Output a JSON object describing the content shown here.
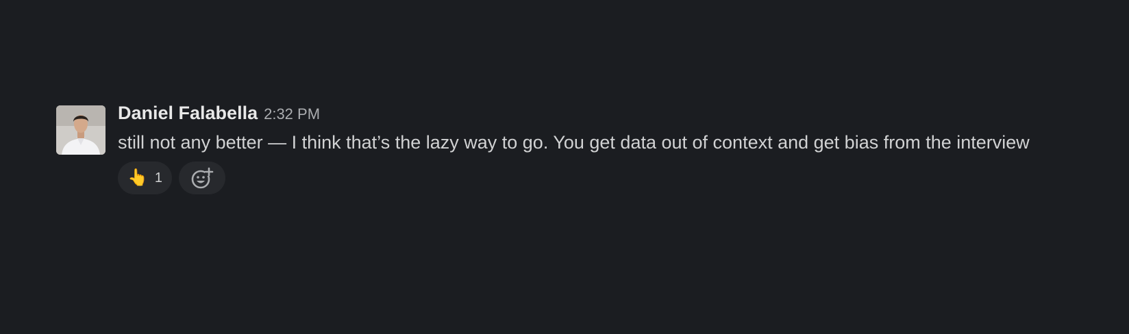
{
  "message": {
    "author": "Daniel Falabella",
    "timestamp": "2:32 PM",
    "text": "still not any better — I think that’s the lazy way to go. You get data out of context and get bias from the interview",
    "avatar_icon": "user-photo",
    "reactions": [
      {
        "emoji": "👆",
        "icon": "pointing-up-emoji",
        "count": "1"
      }
    ],
    "add_reaction_icon": "add-emoji-icon"
  },
  "colors": {
    "background": "#1b1d21",
    "text": "#d1d2d3",
    "author": "#e8e8e8",
    "timestamp": "#abadb0",
    "pill": "#27292d"
  }
}
